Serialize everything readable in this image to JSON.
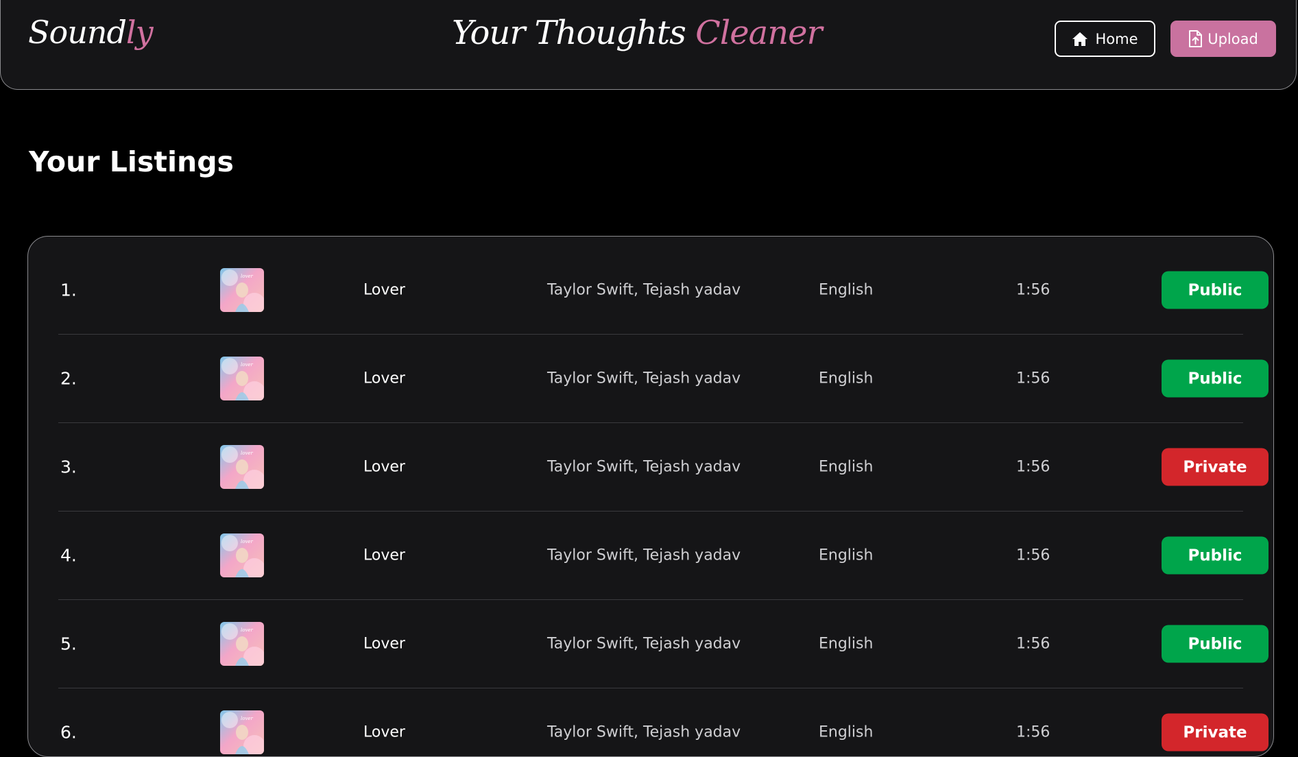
{
  "header": {
    "logo_main": "Sound",
    "logo_accent": "ly",
    "tagline_main": "Your Thoughts",
    "tagline_accent": "Cleaner",
    "home_label": "Home",
    "home_icon": "home-icon",
    "upload_label": "Upload",
    "upload_icon": "file-upload-icon"
  },
  "colors": {
    "background": "#000000",
    "surface": "#151517",
    "accent_pink": "#c9729f",
    "public_green": "#00a54b",
    "private_red": "#d3262b"
  },
  "main": {
    "title": "Your Listings"
  },
  "listings": [
    {
      "number": "1.",
      "title": "Lover",
      "artists": "Taylor Swift, Tejash yadav",
      "language": "English",
      "duration": "1:56",
      "status": "Public"
    },
    {
      "number": "2.",
      "title": "Lover",
      "artists": "Taylor Swift, Tejash yadav",
      "language": "English",
      "duration": "1:56",
      "status": "Public"
    },
    {
      "number": "3.",
      "title": "Lover",
      "artists": "Taylor Swift, Tejash yadav",
      "language": "English",
      "duration": "1:56",
      "status": "Private"
    },
    {
      "number": "4.",
      "title": "Lover",
      "artists": "Taylor Swift, Tejash yadav",
      "language": "English",
      "duration": "1:56",
      "status": "Public"
    },
    {
      "number": "5.",
      "title": "Lover",
      "artists": "Taylor Swift, Tejash yadav",
      "language": "English",
      "duration": "1:56",
      "status": "Public"
    },
    {
      "number": "6.",
      "title": "Lover",
      "artists": "Taylor Swift, Tejash yadav",
      "language": "English",
      "duration": "1:56",
      "status": "Private"
    }
  ]
}
